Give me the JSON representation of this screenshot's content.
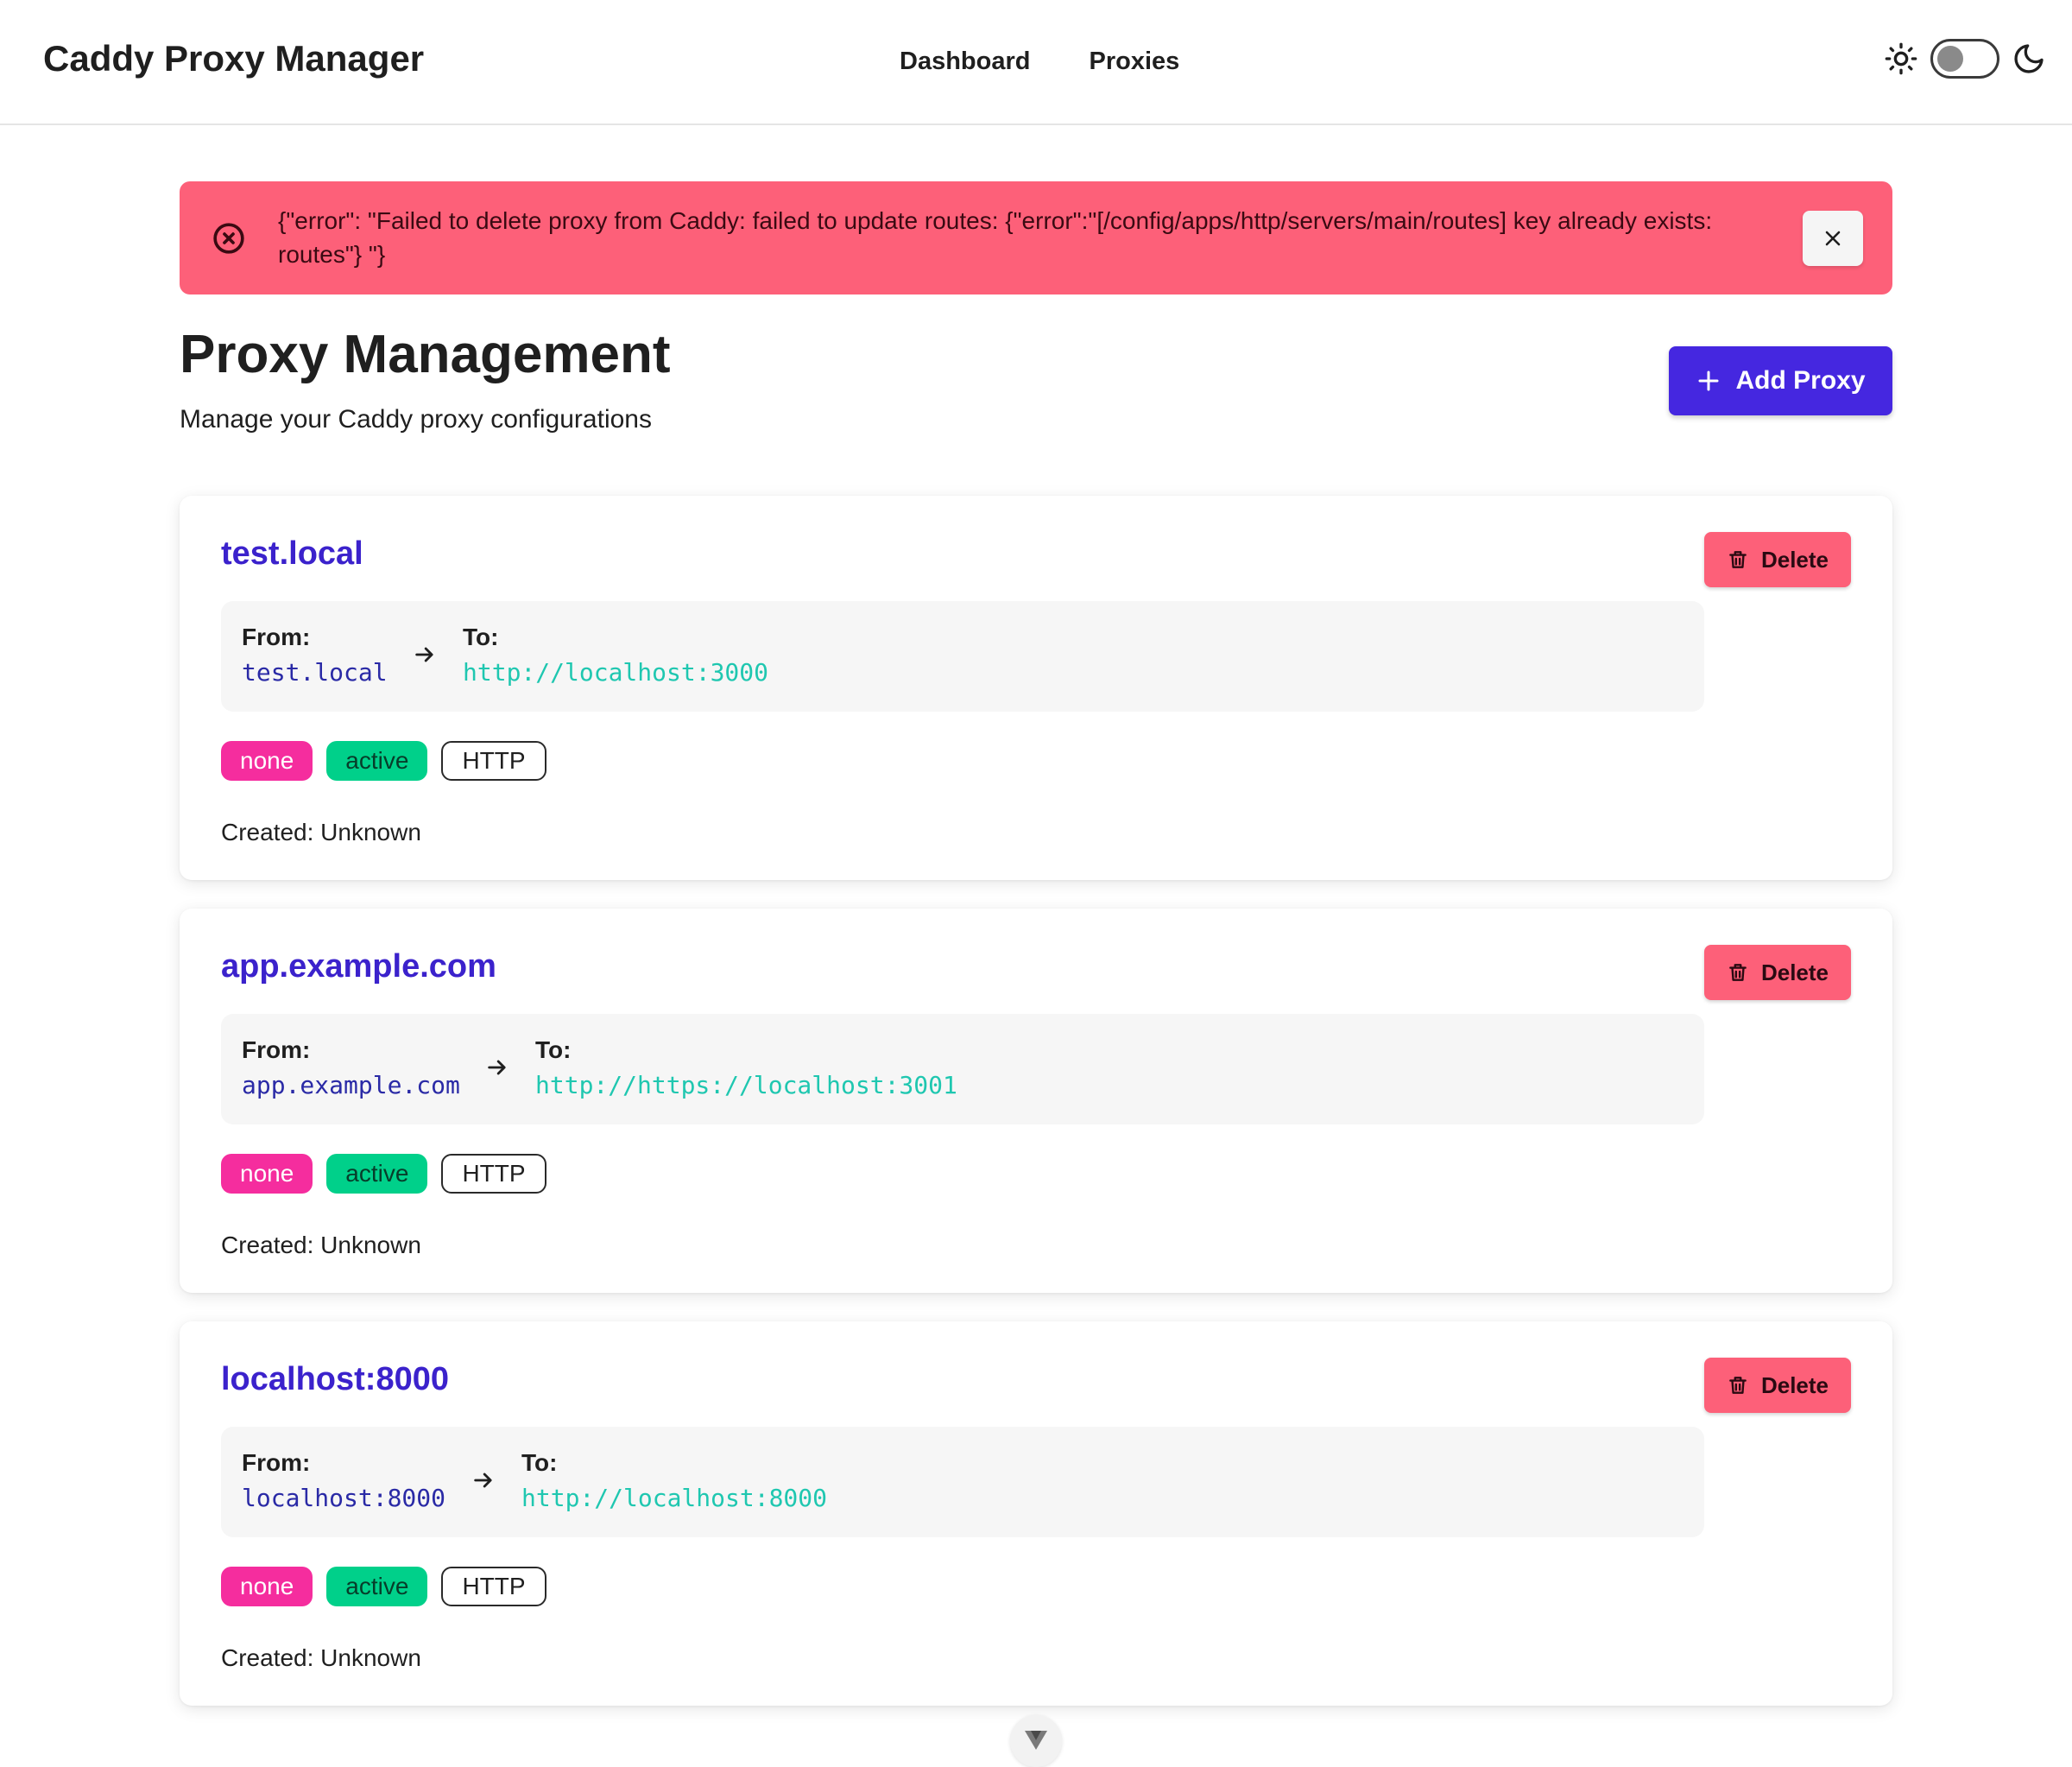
{
  "header": {
    "brand": "Caddy Proxy Manager",
    "nav": [
      {
        "label": "Dashboard"
      },
      {
        "label": "Proxies"
      }
    ],
    "theme": {
      "light_icon": "sun-icon",
      "dark_icon": "moon-icon",
      "mode": "light"
    }
  },
  "alert": {
    "message": "{\"error\": \"Failed to delete proxy from Caddy: failed to update routes: {\"error\":\"[/config/apps/http/servers/main/routes] key already exists: routes\"} \"}",
    "close_label": "×",
    "color": "#fd6079"
  },
  "page": {
    "title": "Proxy Management",
    "subtitle": "Manage your Caddy proxy configurations",
    "add_button": "Add Proxy"
  },
  "proxies": [
    {
      "name": "test.local",
      "from_label": "From:",
      "from": "test.local",
      "to_label": "To:",
      "to": "http://localhost:3000",
      "badges": [
        "none",
        "active",
        "HTTP"
      ],
      "created": "Created: Unknown",
      "delete_label": "Delete"
    },
    {
      "name": "app.example.com",
      "from_label": "From:",
      "from": "app.example.com",
      "to_label": "To:",
      "to": "http://https://localhost:3001",
      "badges": [
        "none",
        "active",
        "HTTP"
      ],
      "created": "Created: Unknown",
      "delete_label": "Delete"
    },
    {
      "name": "localhost:8000",
      "from_label": "From:",
      "from": "localhost:8000",
      "to_label": "To:",
      "to": "http://localhost:8000",
      "badges": [
        "none",
        "active",
        "HTTP"
      ],
      "created": "Created: Unknown",
      "delete_label": "Delete"
    }
  ],
  "colors": {
    "accent": "#4527e0",
    "proxy_title": "#3b22cc",
    "danger": "#fd6079",
    "badge_none": "#f52d9e",
    "badge_active": "#00d08a",
    "to_url": "#1fc7b0"
  }
}
